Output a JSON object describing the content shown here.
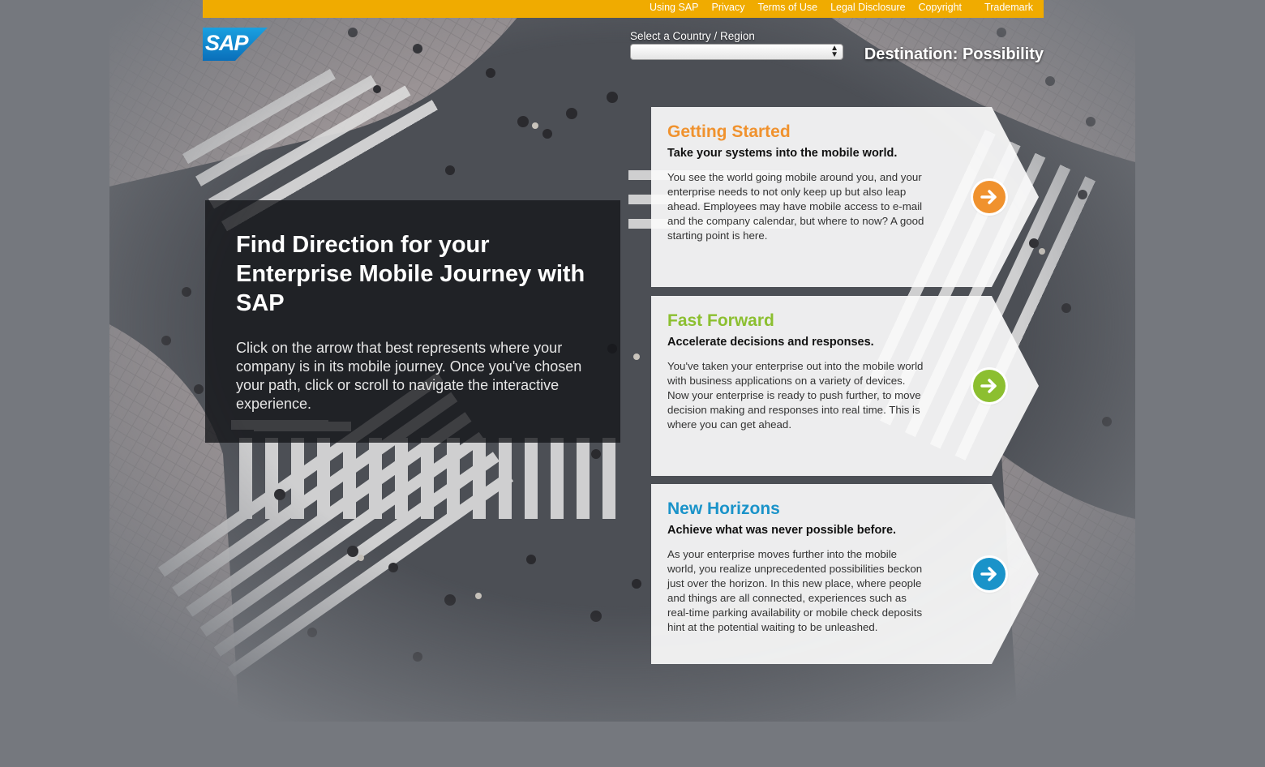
{
  "top_nav": {
    "links": [
      "Using SAP",
      "Privacy",
      "Terms of Use",
      "Legal Disclosure",
      "Copyright",
      "Trademark"
    ]
  },
  "brand": {
    "logo_text": "SAP",
    "color_yellow": "#f0ab00",
    "color_blue": "#0a6fba"
  },
  "country": {
    "label": "Select a Country / Region",
    "selected": ""
  },
  "tagline": "Destination: Possibility",
  "hero": {
    "title": "Find Direction for your Enterprise Mobile Journey with SAP",
    "text": "Click on the arrow that best represents where your company is in its mobile journey. Once you've chosen your path, click or scroll to navigate the interactive experience."
  },
  "cards": [
    {
      "title": "Getting Started",
      "subtitle": "Take your systems into the mobile world.",
      "body": "You see the world going mobile around you, and your enterprise needs to not only keep up but also leap ahead. Employees may have mobile access to e-mail and the company calendar, but where to now? A good starting point is here.",
      "color": "#f0922e",
      "icon": "arrow-right-icon"
    },
    {
      "title": "Fast Forward",
      "subtitle": "Accelerate decisions and responses.",
      "body": "You've taken your enterprise out into the mobile world with business applications on a variety of devices. Now your enterprise is ready to push further, to move decision making and responses into real time. This is where you can get ahead.",
      "color": "#8cbf30",
      "icon": "arrow-right-icon"
    },
    {
      "title": "New Horizons",
      "subtitle": "Achieve what was never possible before.",
      "body": "As your enterprise moves further into the mobile world, you realize unprecedented possibilities beckon just over the horizon. In this new place, where people and things are all connected, experiences such as real-time parking availability or mobile check deposits hint at the potential waiting to be unleashed.",
      "color": "#1a93c9",
      "icon": "arrow-right-icon"
    }
  ]
}
